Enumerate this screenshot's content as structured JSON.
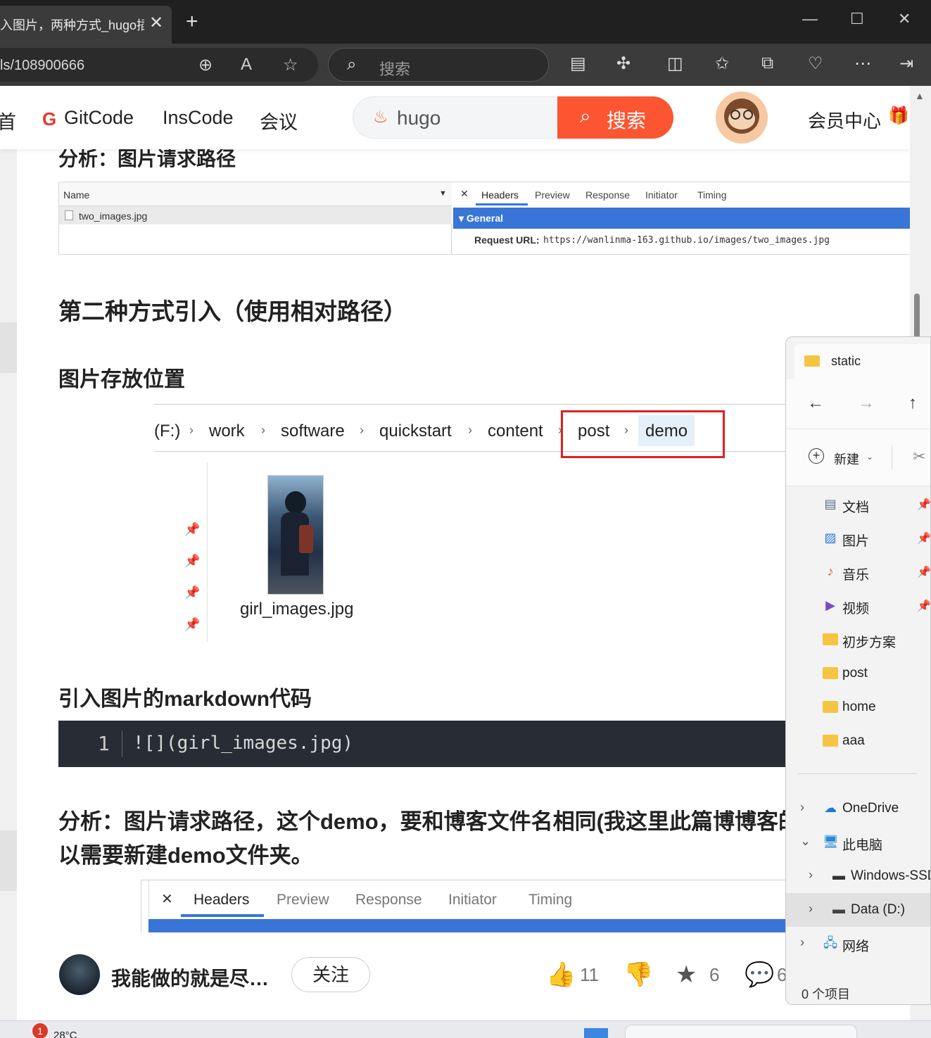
{
  "browser": {
    "tab_title": "入图片，两种方式_hugo插",
    "tab_close": "✕",
    "new_tab": "+",
    "address_text": "ls/108900666",
    "search_placeholder": "搜索",
    "window_controls": [
      "—",
      "☐",
      "✕"
    ]
  },
  "site_header": {
    "nav": [
      "首",
      "GitCode",
      "InsCode",
      "会议"
    ],
    "gitcode_logo": "G",
    "search_value": "hugo",
    "search_button": "搜索",
    "member_center": "会员中心"
  },
  "article": {
    "heading_top": "分析：图片请求路径",
    "devtools_1": {
      "name_col": "Name",
      "file": "two_images.jpg",
      "close": "✕",
      "tabs": [
        "Headers",
        "Preview",
        "Response",
        "Initiator",
        "Timing"
      ],
      "section": "▾ General",
      "request_url_label": "Request URL:",
      "request_url": "https://wanlinma-163.github.io/images/two_images.jpg"
    },
    "heading_2": "第二种方式引入（使用相对路径）",
    "heading_3": "图片存放位置",
    "breadcrumb": [
      "(F:)",
      "work",
      "software",
      "quickstart",
      "content",
      "post",
      "demo"
    ],
    "breadcrumb_sep": "›",
    "image_file": "girl_images.jpg",
    "heading_4": "引入图片的markdown代码",
    "code": {
      "line_no": "1",
      "text": "![](girl_images.jpg)"
    },
    "analysis_line1": "分析：图片请求路径，这个demo，要和博客文件名相同(我这里此篇博博客的文",
    "analysis_line2": "以需要新建demo文件夹。",
    "devtools_2": {
      "close": "✕",
      "tabs": [
        "Headers",
        "Preview",
        "Response",
        "Initiator",
        "Timing"
      ]
    }
  },
  "bottom_bar": {
    "author": "我能做的就是尽…",
    "follow": "关注",
    "likes": "11",
    "stars": "6",
    "comments": "6"
  },
  "file_explorer": {
    "title": "static",
    "nav": [
      "←",
      "→",
      "↑"
    ],
    "new_label": "新建",
    "quick_access": [
      {
        "label": "文档",
        "icon": "document-icon",
        "pinned": true
      },
      {
        "label": "图片",
        "icon": "pictures-icon",
        "pinned": true
      },
      {
        "label": "音乐",
        "icon": "music-icon",
        "pinned": true
      },
      {
        "label": "视频",
        "icon": "video-icon",
        "pinned": true
      },
      {
        "label": "初步方案",
        "icon": "folder-icon",
        "pinned": false
      },
      {
        "label": "post",
        "icon": "folder-icon",
        "pinned": false
      },
      {
        "label": "home",
        "icon": "folder-icon",
        "pinned": false
      },
      {
        "label": "aaa",
        "icon": "folder-icon",
        "pinned": false
      }
    ],
    "tree": [
      {
        "label": "OneDrive",
        "chevron": "›"
      },
      {
        "label": "此电脑",
        "chevron": "⌄"
      },
      {
        "label": "Windows-SSD",
        "chevron": "›"
      },
      {
        "label": "Data (D:)",
        "chevron": "›",
        "selected": true
      },
      {
        "label": "网络",
        "chevron": "›"
      }
    ],
    "status": "0 个项目"
  },
  "taskbar": {
    "weather_badge": "1",
    "temperature": "28°C"
  },
  "colors": {
    "accent": "#fc5531",
    "devtools_blue": "#3875d7",
    "highlight_red": "#e02020",
    "code_bg": "#282c34"
  }
}
